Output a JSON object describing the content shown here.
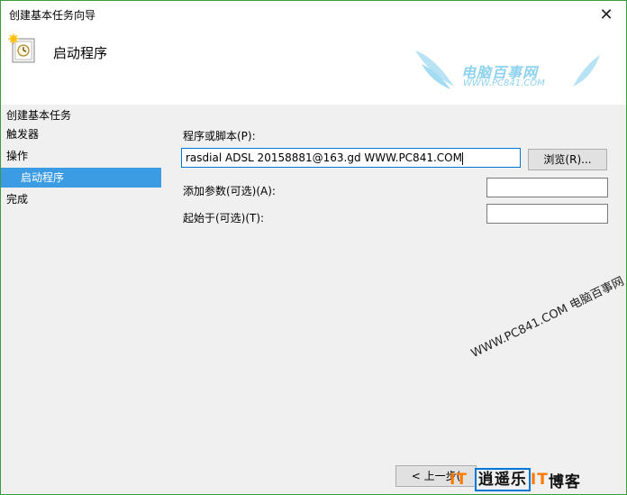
{
  "window": {
    "title": "创建基本任务向导",
    "close_glyph": "✕"
  },
  "header": {
    "title": "启动程序"
  },
  "watermark": {
    "name": "电脑百事网",
    "url": "WWW.PC841.COM"
  },
  "sidebar": {
    "heading": "创建基本任务",
    "items": [
      {
        "label": "触发器"
      },
      {
        "label": "操作"
      },
      {
        "label": "启动程序"
      },
      {
        "label": "完成"
      }
    ]
  },
  "form": {
    "program_label": "程序或脚本(P):",
    "program_value": "rasdial ADSL 20158881@163.gd WWW.PC841.COM",
    "browse_label": "浏览(R)...",
    "args_label": "添加参数(可选)(A):",
    "args_value": "",
    "start_label": "起始于(可选)(T):",
    "start_value": ""
  },
  "footer": {
    "back_label": "< 上一步(",
    "diagonal_watermark": "WWW.PC841.COM 电脑百事网",
    "brand_a": "逍遥乐",
    "brand_it": "IT",
    "brand_b": "博客"
  },
  "colors": {
    "selected": "#3b9be3",
    "focus": "#0078d7",
    "window_border": "#3c9b3c"
  }
}
